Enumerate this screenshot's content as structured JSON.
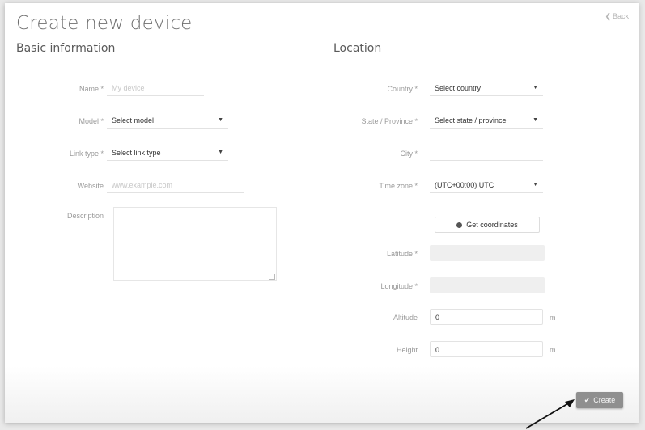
{
  "header": {
    "title": "Create new device",
    "back_label": "Back"
  },
  "basic": {
    "heading": "Basic information",
    "name": {
      "label": "Name *",
      "placeholder": "My device"
    },
    "model": {
      "label": "Model *",
      "value": "Select model"
    },
    "link_type": {
      "label": "Link type *",
      "value": "Select link type"
    },
    "website": {
      "label": "Website",
      "placeholder": "www.example.com"
    },
    "description": {
      "label": "Description"
    }
  },
  "location": {
    "heading": "Location",
    "country": {
      "label": "Country *",
      "value": "Select country"
    },
    "state": {
      "label": "State / Province *",
      "value": "Select state / province"
    },
    "city": {
      "label": "City *"
    },
    "time_zone": {
      "label": "Time zone *",
      "value": "(UTC+00:00) UTC"
    },
    "get_coordinates": "Get coordinates",
    "latitude": {
      "label": "Latitude *"
    },
    "longitude": {
      "label": "Longitude *"
    },
    "altitude": {
      "label": "Altitude",
      "value": "0",
      "unit": "m"
    },
    "height": {
      "label": "Height",
      "value": "0",
      "unit": "m"
    }
  },
  "actions": {
    "create_label": "Create"
  }
}
